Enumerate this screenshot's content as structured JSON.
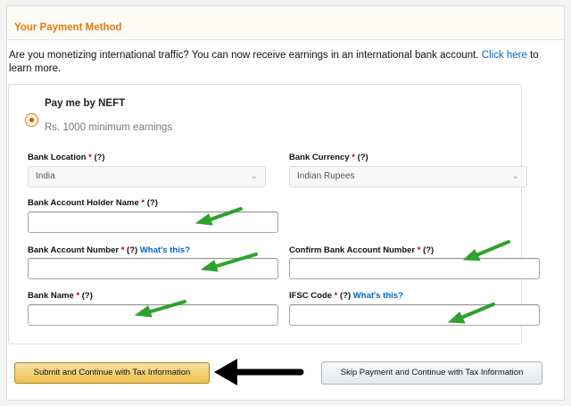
{
  "panel": {
    "title": "Your Payment Method",
    "intro_text": "Are you monetizing international traffic? You can now receive earnings in an international bank account. ",
    "intro_link": "Click here",
    "intro_tail": " to learn more."
  },
  "option": {
    "title": "Pay me by NEFT",
    "subtitle": "Rs. 1000 minimum earnings",
    "selected": true
  },
  "fields": {
    "bank_location": {
      "label": "Bank Location",
      "req": "*",
      "help": "(?)",
      "value": "India"
    },
    "bank_currency": {
      "label": "Bank Currency",
      "req": "*",
      "help": "(?)",
      "value": "Indian Rupees"
    },
    "holder_name": {
      "label": "Bank Account Holder Name",
      "req": "*",
      "help": "(?)"
    },
    "account_number": {
      "label": "Bank Account Number",
      "req": "*",
      "help": "(?)",
      "link": "What's this?"
    },
    "confirm_account": {
      "label": "Confirm Bank Account Number",
      "req": "*",
      "help": "(?)"
    },
    "bank_name": {
      "label": "Bank Name",
      "req": "*",
      "help": "(?)"
    },
    "ifsc": {
      "label": "IFSC Code",
      "req": "*",
      "help": "(?)",
      "link": "What's this?"
    }
  },
  "buttons": {
    "submit": "Submit and Continue with Tax Information",
    "skip": "Skip Payment and Continue with Tax Information"
  },
  "colors": {
    "accent": "#e47911",
    "link": "#0066c0",
    "annotation_green": "#2ea12e",
    "annotation_black": "#000000"
  }
}
